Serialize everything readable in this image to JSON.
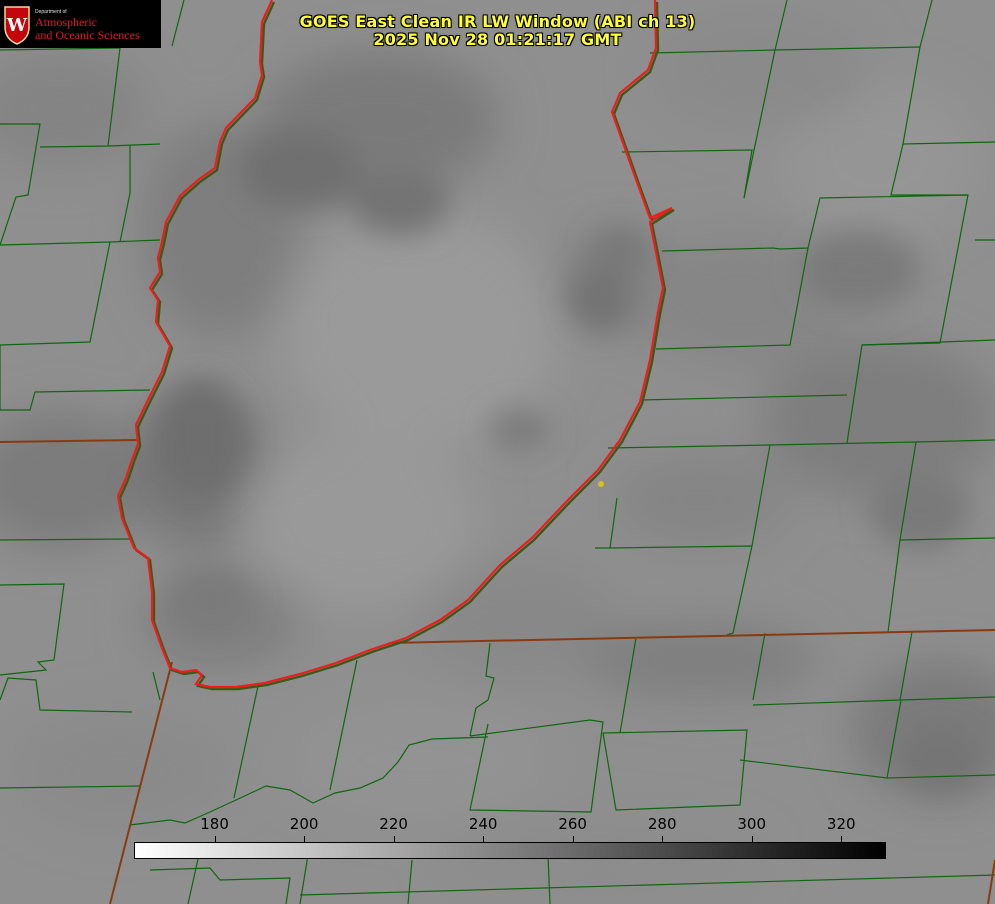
{
  "title": {
    "line1": "GOES East Clean IR LW Window (ABI ch 13)",
    "line2": "2025 Nov 28 01:21:17 GMT"
  },
  "logo": {
    "dept": "Department of",
    "line1": "Atmospheric",
    "line2": "and Oceanic Sciences",
    "crest_letter": "W"
  },
  "colorbar": {
    "ticks": [
      "180",
      "200",
      "220",
      "240",
      "260",
      "280",
      "300",
      "320"
    ],
    "range": [
      162,
      330
    ],
    "color_min": "#ffffff",
    "color_max": "#000000"
  },
  "colors": {
    "county_lines": "#116611",
    "state_lines": "#8a3a10",
    "lake_shore": "#ee1c1c",
    "marker": "#d4c21a",
    "title": "#ffff33"
  }
}
